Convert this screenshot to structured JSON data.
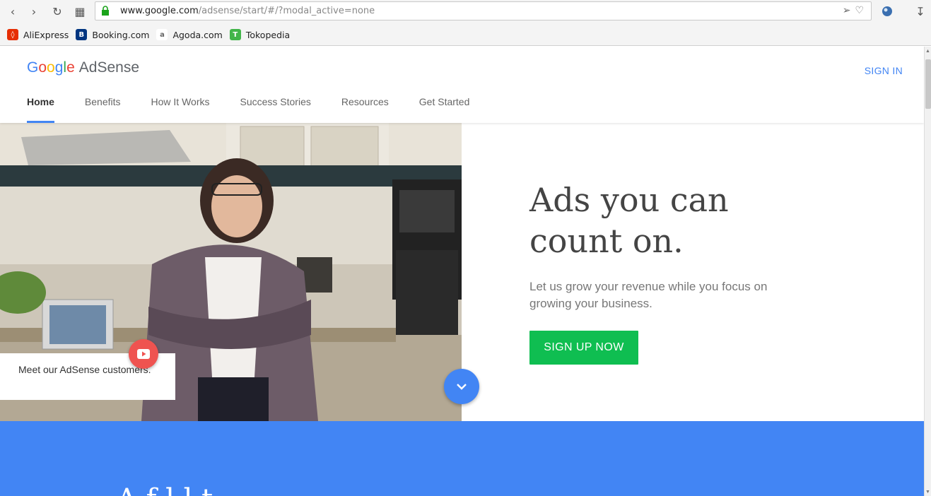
{
  "browser": {
    "url_host": "www.google.com",
    "url_path": "/adsense/start/#/?modal_active=none",
    "bookmarks": [
      {
        "label": "AliExpress",
        "icon": "aliexpress-icon",
        "color": "#e62e04"
      },
      {
        "label": "Booking.com",
        "icon": "booking-icon",
        "color": "#003580"
      },
      {
        "label": "Agoda.com",
        "icon": "agoda-icon",
        "color": "#888888"
      },
      {
        "label": "Tokopedia",
        "icon": "tokopedia-icon",
        "color": "#42b549"
      }
    ]
  },
  "header": {
    "logo_google": "Google",
    "logo_product": "AdSense",
    "sign_in": "SIGN IN",
    "nav": [
      {
        "label": "Home",
        "active": true
      },
      {
        "label": "Benefits"
      },
      {
        "label": "How It Works"
      },
      {
        "label": "Success Stories"
      },
      {
        "label": "Resources"
      },
      {
        "label": "Get Started"
      }
    ]
  },
  "hero": {
    "headline_line1": "Ads you can",
    "headline_line2": "count on.",
    "subtext": "Let us grow your revenue while you focus on growing your business.",
    "cta": "SIGN UP NOW",
    "video_card": "Meet our AdSense customers."
  },
  "band": {
    "partial_heading": "A f                 l    l     t"
  },
  "colors": {
    "accent": "#4285f4",
    "cta": "#0fbe51",
    "youtube": "#ef5350"
  }
}
